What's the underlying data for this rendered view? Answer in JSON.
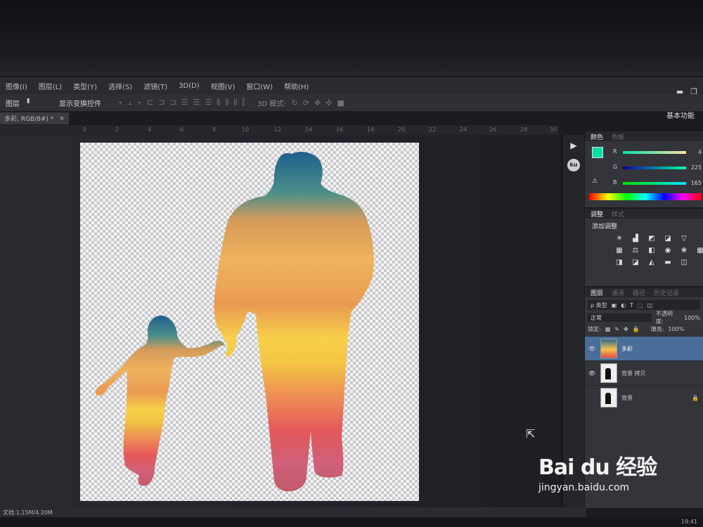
{
  "menu": {
    "items": [
      "图像(I)",
      "图层(L)",
      "类型(Y)",
      "选择(S)",
      "滤镜(T)",
      "3D(D)",
      "视图(V)",
      "窗口(W)",
      "帮助(H)"
    ]
  },
  "options_bar": {
    "select_value": "图层",
    "transform_controls_label": "显示变换控件",
    "mode_3d_label": "3D 模式:"
  },
  "workspace_label": "基本功能",
  "document_tab": {
    "title": "多彩, RGB/8#) *",
    "close": "×"
  },
  "ruler": {
    "ticks": [
      "0",
      "2",
      "4",
      "6",
      "8",
      "10",
      "12",
      "14",
      "16",
      "18",
      "20",
      "22",
      "24",
      "26",
      "28",
      "30"
    ]
  },
  "status_bar": {
    "doc_info": "文档:1.15M/4.20M"
  },
  "taskbar": {
    "clock": "19:41"
  },
  "color_panel": {
    "tabs": [
      "颜色",
      "色板"
    ],
    "channels": [
      {
        "label": "R",
        "value": "4"
      },
      {
        "label": "G",
        "value": "225"
      },
      {
        "label": "B",
        "value": "165"
      }
    ],
    "foreground_color": "#04e1a5"
  },
  "adjustments_panel": {
    "tabs": [
      "调整",
      "样式"
    ],
    "title": "添加调整",
    "icons": [
      "brightness-icon",
      "levels-icon",
      "curves-icon",
      "exposure-icon",
      "vibrance-icon",
      "hue-icon",
      "color-balance-icon",
      "bw-icon",
      "photo-filter-icon",
      "channel-mixer-icon",
      "color-lookup-icon",
      "invert-icon",
      "posterize-icon",
      "threshold-icon",
      "gradient-map-icon",
      "selective-color-icon"
    ]
  },
  "layers_panel": {
    "tabs": [
      "图层",
      "通道",
      "路径",
      "历史记录"
    ],
    "filter_label": "ρ 类型",
    "blend_mode": "正常",
    "opacity_label": "不透明度:",
    "opacity_value": "100%",
    "lock_label": "锁定:",
    "fill_label": "填充:",
    "fill_value": "100%",
    "layers": [
      {
        "name": "多彩",
        "visible": true,
        "active": true
      },
      {
        "name": "背景 拷贝",
        "visible": true,
        "active": false
      },
      {
        "name": "背景",
        "visible": false,
        "active": false
      }
    ]
  },
  "watermark": {
    "logo": "Bai du 经验",
    "url": "jingyan.baidu.com"
  }
}
